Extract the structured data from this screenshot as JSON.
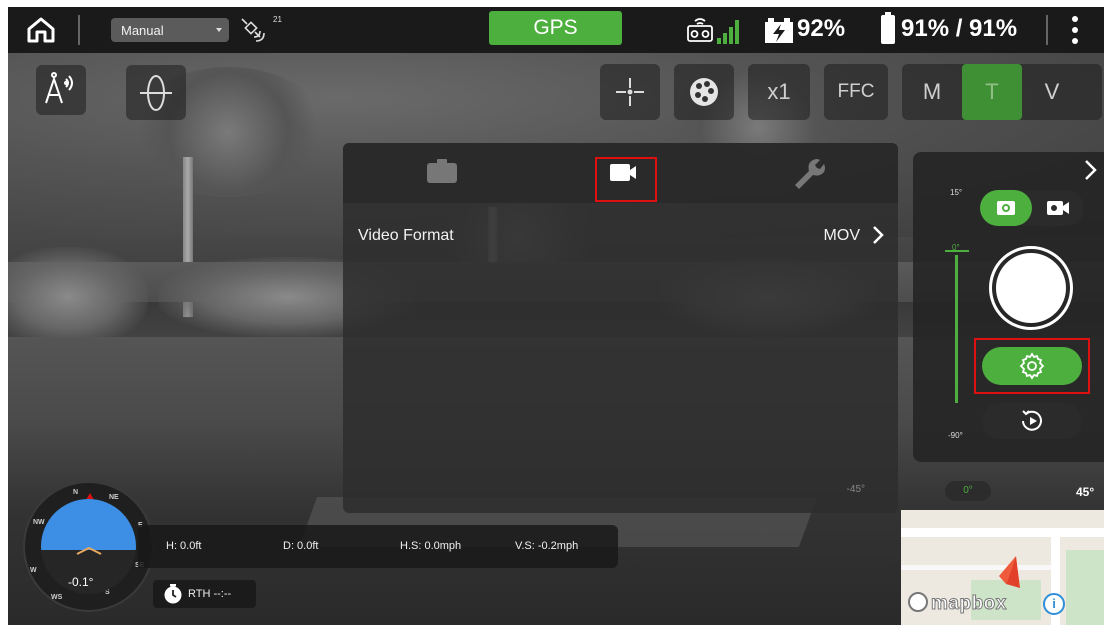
{
  "topbar": {
    "flight_mode": "Manual",
    "satellite_count": "21",
    "gps_label": "GPS",
    "drone_battery": "92%",
    "rc_battery": "91% / 91%"
  },
  "toolbar": {
    "zoom_label": "x1",
    "ffc_label": "FFC",
    "mode_m": "M",
    "mode_t": "T",
    "mode_v": "V"
  },
  "settings_panel": {
    "tabs": [
      "photo",
      "video",
      "tools"
    ],
    "active_tab": "video",
    "rows": [
      {
        "label": "Video Format",
        "value": "MOV"
      }
    ],
    "angle_label": "-45°"
  },
  "capture_panel": {
    "gimbal_top_label": "15°",
    "gimbal_zero_label": "0°",
    "gimbal_bottom_label": "-90°",
    "pitch_zero_label": "0°",
    "pitch_max_label": "45°"
  },
  "telemetry": {
    "height": "H: 0.0ft",
    "distance": "D: 0.0ft",
    "horizontal_speed": "H.S: 0.0mph",
    "vertical_speed": "V.S: -0.2mph",
    "rth": "RTH --:--"
  },
  "attitude": {
    "pitch": "-0.1°",
    "compass_labels": [
      "N",
      "NE",
      "E",
      "SE",
      "S",
      "WS",
      "W",
      "NW"
    ]
  },
  "map": {
    "attribution": "mapbox"
  },
  "colors": {
    "accent_green": "#4caf3e",
    "highlight_red": "#e01010",
    "sky_blue": "#3d8fe6"
  }
}
